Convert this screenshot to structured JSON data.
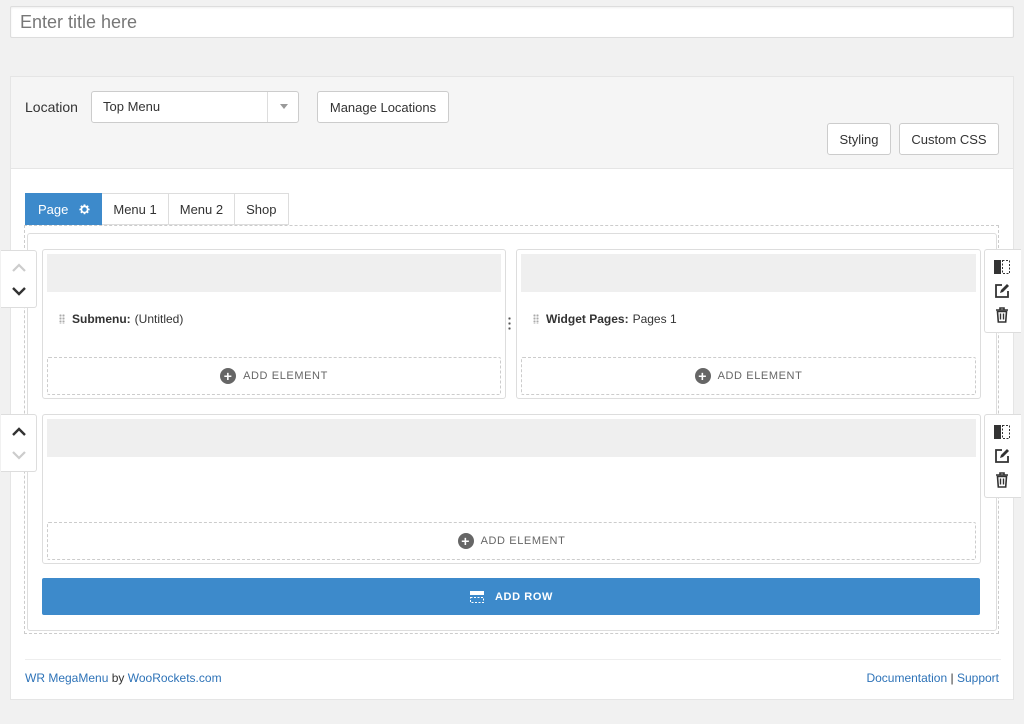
{
  "title_input": {
    "placeholder": "Enter title here",
    "value": ""
  },
  "location": {
    "label": "Location",
    "selected": "Top Menu",
    "manage_label": "Manage Locations"
  },
  "toolbar": {
    "styling_label": "Styling",
    "custom_css_label": "Custom CSS"
  },
  "tabs": [
    {
      "label": "Page",
      "active": true
    },
    {
      "label": "Menu 1",
      "active": false
    },
    {
      "label": "Menu 2",
      "active": false
    },
    {
      "label": "Shop",
      "active": false
    }
  ],
  "rows": [
    {
      "columns": [
        {
          "item_label": "Submenu:",
          "item_value": "(Untitled)",
          "add_label": "ADD ELEMENT"
        },
        {
          "item_label": "Widget Pages:",
          "item_value": "Pages 1",
          "add_label": "ADD ELEMENT"
        }
      ]
    },
    {
      "columns": [
        {
          "add_label": "ADD ELEMENT"
        }
      ]
    }
  ],
  "add_row_label": "ADD ROW",
  "footer": {
    "product": "WR MegaMenu",
    "by": "by",
    "vendor": "WooRockets.com",
    "documentation": "Documentation",
    "separator": "|",
    "support": "Support"
  },
  "colors": {
    "accent": "#3d8acb",
    "link": "#2e73b8"
  }
}
